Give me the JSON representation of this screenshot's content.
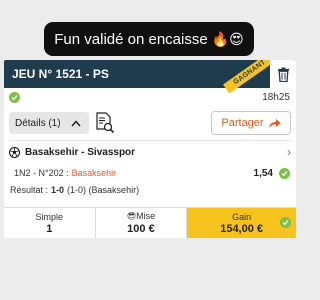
{
  "caption": {
    "text": "Fun validé on encaisse",
    "emoji": "🔥😍"
  },
  "ticket": {
    "title": "JEU N° 1521 - PS",
    "badge": "GAGNANT",
    "time": "18h25",
    "details_label": "Détails (1)",
    "share_label": "Partager",
    "match": "Basaksehir - Sivasspor",
    "bet_prefix": "1N2 - N°202 :",
    "bet_selection": "Basaksehir",
    "odds": "1,54",
    "result_prefix": "Résultat :",
    "result_score": "1-0",
    "result_detail": "(1-0) (Basaksehir)"
  },
  "summary": {
    "type_label": "Simple",
    "type_value": "1",
    "stake_label": "Mise",
    "stake_value": "100 €",
    "gain_label": "Gain",
    "gain_value": "154,00 €"
  },
  "colors": {
    "header": "#1f3b4e",
    "ribbon": "#f6c21e",
    "accent": "#e05a22",
    "check": "#7cc142"
  }
}
